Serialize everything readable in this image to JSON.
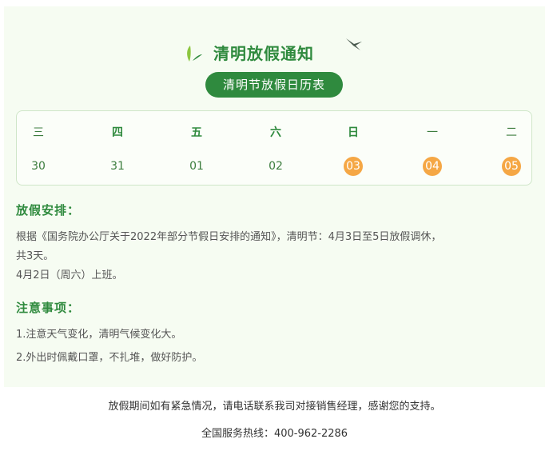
{
  "notice": {
    "title": "清明放假通知",
    "subtitle": "清明节放假日历表",
    "icons": {
      "leaf": "leaf-icon",
      "swallow": "swallow-icon"
    }
  },
  "calendar": {
    "weekdays": [
      "三",
      "四",
      "五",
      "六",
      "日",
      "一",
      "二"
    ],
    "dates": [
      "30",
      "31",
      "01",
      "02",
      "03",
      "04",
      "05"
    ],
    "highlighted": [
      false,
      false,
      false,
      false,
      true,
      true,
      true
    ],
    "highlight_color": "#f5a745"
  },
  "arrangement": {
    "heading": "放假安排：",
    "line1": "根据《国务院办公厅关于2022年部分节假日安排的通知》，清明节：4月3日至5日放假调休，",
    "line2": "共3天。",
    "line3": "4月2日（周六）上班。"
  },
  "notes": {
    "heading": "注意事项：",
    "item1": "1.注意天气变化，清明气候变化大。",
    "item2": "2.外出时佩戴口罩，不扎堆，做好防护。"
  },
  "footer": {
    "note": "放假期间如有紧急情况，请电话联系我司对接销售经理，感谢您的支持。",
    "hotline": "全国服务热线：400-962-2286"
  },
  "colors": {
    "brand_green": "#2f8a3e",
    "background": "#f6fcf2"
  }
}
